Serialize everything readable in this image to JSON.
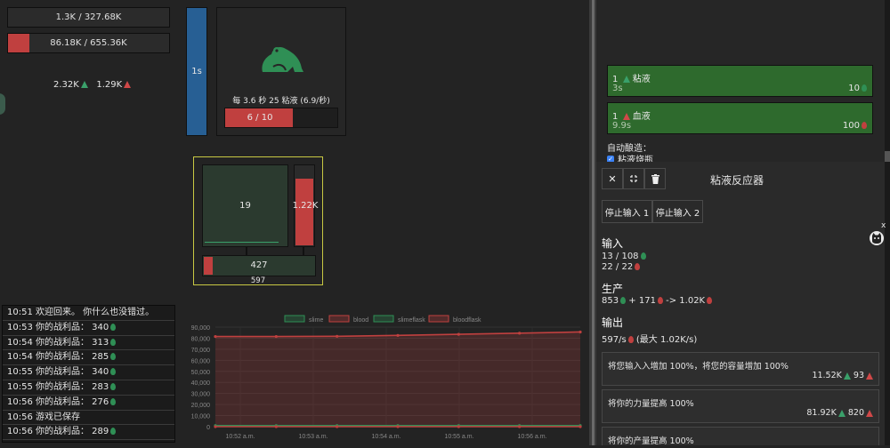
{
  "left": {
    "bar1": "1.3K / 327.68K",
    "bar2": "86.18K / 655.36K",
    "bar2_fill_fraction": 0.13,
    "counts": {
      "green": "2.32K",
      "red": "1.29K"
    }
  },
  "log": [
    "10:51 欢迎回来。 你什么也没错过。",
    "10:53 你的战利品： 340",
    "10:54 你的战利品： 313",
    "10:54 你的战利品： 285",
    "10:55 你的战利品： 340",
    "10:55 你的战利品： 283",
    "10:56 你的战利品： 276",
    "10:56 游戏已保存",
    "10:56 你的战利品： 289"
  ],
  "log_has_drop": [
    false,
    true,
    true,
    true,
    true,
    true,
    true,
    false,
    true
  ],
  "timer": {
    "label": "1s"
  },
  "frog": {
    "rate_text": "每 3.6 秒 25 粘液 (6.9/秒)",
    "progress": "6 / 10",
    "progress_fraction": 0.6
  },
  "reactor": {
    "left_value": "19",
    "right_value": "1.22K",
    "right_fill_fraction": 0.85,
    "bottom_value": "427",
    "bottom_fill_fraction": 0.08,
    "below": "597"
  },
  "chart_data": {
    "type": "line",
    "legend": [
      "slime",
      "blood",
      "slimeflask",
      "bloodflask"
    ],
    "x": [
      "10:52 a.m.",
      "10:53 a.m.",
      "10:54 a.m.",
      "10:55 a.m.",
      "10:56 a.m."
    ],
    "yticks": [
      "0",
      "10,000",
      "20,000",
      "30,000",
      "40,000",
      "50,000",
      "60,000",
      "70,000",
      "80,000",
      "90,000"
    ],
    "ylim": [
      0,
      90000
    ],
    "series": [
      {
        "name": "slime",
        "color": "#2f8f55",
        "values": [
          300,
          300,
          300,
          300,
          300,
          300,
          300
        ]
      },
      {
        "name": "blood",
        "color": "#c0403f",
        "values": [
          81500,
          81500,
          81700,
          82500,
          83500,
          84500,
          85600
        ]
      },
      {
        "name": "slimeflask",
        "color": "#2f8f55",
        "values": [
          1000,
          1000,
          1000,
          1000,
          1000,
          1000,
          1000
        ]
      },
      {
        "name": "bloodflask",
        "color": "#c0403f",
        "values": [
          0,
          0,
          0,
          0,
          0,
          0,
          0
        ]
      }
    ]
  },
  "recipes": [
    {
      "qty": "1",
      "name": "粘液",
      "time": "3s",
      "cost": "10",
      "icon": "green"
    },
    {
      "qty": "1",
      "name": "血液",
      "time": "9.9s",
      "cost": "100",
      "icon": "red"
    }
  ],
  "auto": {
    "label": "自动酿造：",
    "checkbox_label": "粘液烧瓶"
  },
  "panel": {
    "title": "粘液反应器",
    "btn_stop1": "停止输入 1",
    "btn_stop2": "停止输入 2",
    "input_title": "输入",
    "input1": "13 / 108",
    "input2": "22 / 22",
    "prod_title": "生产",
    "prod_a": "853",
    "prod_b": "+ 171",
    "prod_c": "-> 1.02K",
    "out_title": "输出",
    "out_a": "597/s",
    "out_b": "(最大 1.02K/s)"
  },
  "upgrades": [
    {
      "text": "将您输入入增加 100%，将您的容量增加 100%",
      "cost1": "11.52K",
      "cost2": "93"
    },
    {
      "text": "将你的力量提高 100%",
      "cost1": "81.92K",
      "cost2": "820"
    },
    {
      "text": "将你的产量提高 100%",
      "cost1": "",
      "cost2": ""
    }
  ],
  "close_x": "x"
}
